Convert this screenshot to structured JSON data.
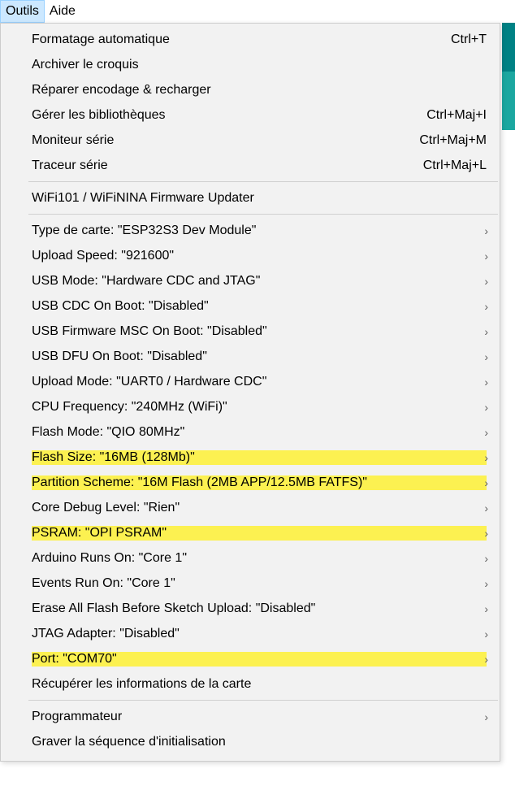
{
  "menubar": {
    "tools": "Outils",
    "help": "Aide"
  },
  "menu": {
    "autoformat": {
      "label": "Formatage automatique",
      "shortcut": "Ctrl+T"
    },
    "archive": {
      "label": "Archiver le croquis"
    },
    "fixreload": {
      "label": "Réparer encodage & recharger"
    },
    "managelibs": {
      "label": "Gérer les bibliothèques",
      "shortcut": "Ctrl+Maj+I"
    },
    "serialmon": {
      "label": "Moniteur série",
      "shortcut": "Ctrl+Maj+M"
    },
    "serialplot": {
      "label": "Traceur série",
      "shortcut": "Ctrl+Maj+L"
    },
    "wifiupdater": {
      "label": "WiFi101 / WiFiNINA Firmware Updater"
    },
    "boardtype": {
      "label": "Type de carte: \"ESP32S3 Dev Module\""
    },
    "uploadspeed": {
      "label": "Upload Speed: \"921600\""
    },
    "usbmode": {
      "label": "USB Mode: \"Hardware CDC and JTAG\""
    },
    "usbcdc": {
      "label": "USB CDC On Boot: \"Disabled\""
    },
    "usbmsc": {
      "label": "USB Firmware MSC On Boot: \"Disabled\""
    },
    "usbdfu": {
      "label": "USB DFU On Boot: \"Disabled\""
    },
    "uploadmode": {
      "label": "Upload Mode: \"UART0 / Hardware CDC\""
    },
    "cpufreq": {
      "label": "CPU Frequency: \"240MHz (WiFi)\""
    },
    "flashmode": {
      "label": "Flash Mode: \"QIO 80MHz\""
    },
    "flashsize": {
      "label": "Flash Size: \"16MB (128Mb)\""
    },
    "partition": {
      "label": "Partition Scheme: \"16M Flash (2MB APP/12.5MB FATFS)\""
    },
    "debuglevel": {
      "label": "Core Debug Level: \"Rien\""
    },
    "psram": {
      "label": "PSRAM: \"OPI PSRAM\""
    },
    "arduinoruns": {
      "label": "Arduino Runs On: \"Core 1\""
    },
    "eventsrun": {
      "label": "Events Run On: \"Core 1\""
    },
    "eraseflash": {
      "label": "Erase All Flash Before Sketch Upload: \"Disabled\""
    },
    "jtag": {
      "label": "JTAG Adapter: \"Disabled\""
    },
    "port": {
      "label": "Port: \"COM70\""
    },
    "getinfo": {
      "label": "Récupérer les informations de la carte"
    },
    "programmer": {
      "label": "Programmateur"
    },
    "burnboot": {
      "label": "Graver la séquence d'initialisation"
    }
  },
  "arrow": "›"
}
